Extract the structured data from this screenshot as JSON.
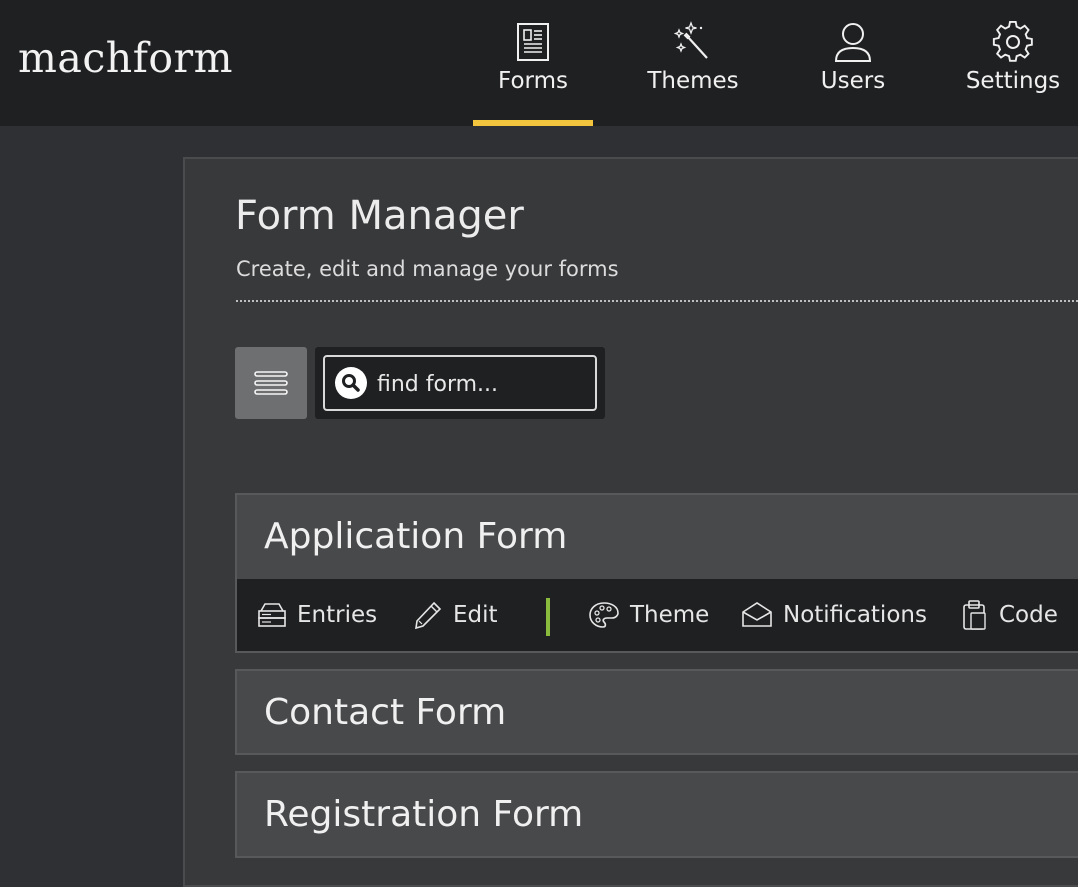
{
  "header": {
    "logo_text": "machform",
    "nav": [
      {
        "label": "Forms",
        "icon": "forms-icon",
        "active": true
      },
      {
        "label": "Themes",
        "icon": "magic-wand-icon",
        "active": false
      },
      {
        "label": "Users",
        "icon": "user-icon",
        "active": false
      },
      {
        "label": "Settings",
        "icon": "gear-icon",
        "active": false
      }
    ],
    "active_color": "#f3c43d"
  },
  "main": {
    "title": "Form Manager",
    "subtitle": "Create, edit and manage your forms",
    "search": {
      "placeholder": "find form..."
    },
    "forms": [
      {
        "title": "Application Form",
        "expanded": true,
        "actions": [
          {
            "label": "Entries",
            "icon": "entries-icon"
          },
          {
            "label": "Edit",
            "icon": "pencil-icon"
          },
          {
            "label": "Theme",
            "icon": "palette-icon"
          },
          {
            "label": "Notifications",
            "icon": "envelope-icon"
          },
          {
            "label": "Code",
            "icon": "clipboard-icon"
          }
        ]
      },
      {
        "title": "Contact Form",
        "expanded": false
      },
      {
        "title": "Registration Form",
        "expanded": false
      }
    ],
    "divider_color": "#8bbb3d"
  }
}
